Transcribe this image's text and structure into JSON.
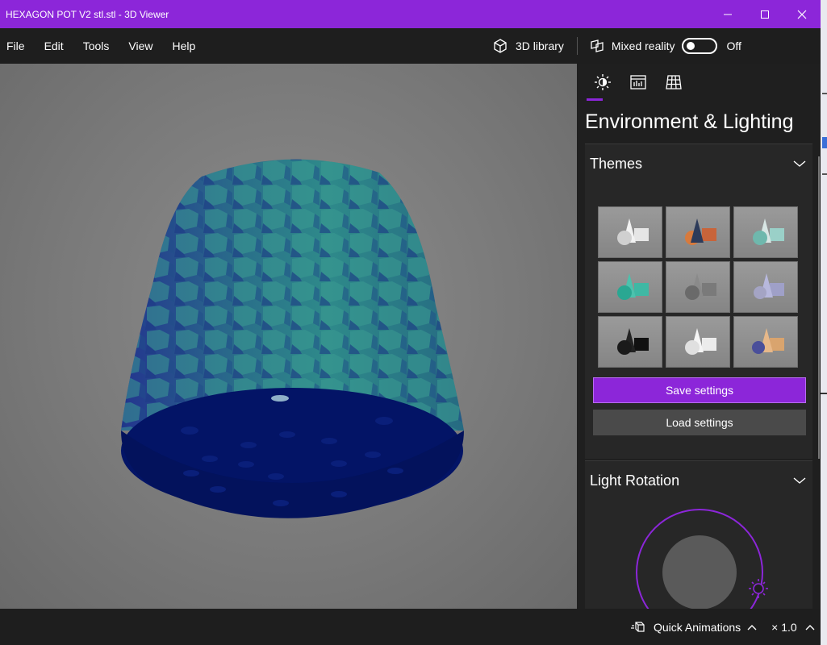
{
  "window": {
    "title": "HEXAGON POT V2 stl.stl - 3D Viewer",
    "accent": "#8c26d9"
  },
  "menu": {
    "items": [
      "File",
      "Edit",
      "Tools",
      "View",
      "Help"
    ],
    "library_label": "3D library",
    "mixed_reality_label": "Mixed reality",
    "mixed_reality_state": "Off"
  },
  "panel": {
    "tabs": [
      {
        "icon": "sun-settings-icon",
        "active": true
      },
      {
        "icon": "stats-icon",
        "active": false
      },
      {
        "icon": "grid-icon",
        "active": false
      }
    ],
    "heading": "Environment & Lighting",
    "themes_label": "Themes",
    "themes": [
      {
        "shapes": "white",
        "bg": "#9a9a9a"
      },
      {
        "shapes": "dark-orange",
        "bg": "#8f8f8f"
      },
      {
        "shapes": "teal-white",
        "bg": "#9a9a9a"
      },
      {
        "shapes": "teal",
        "bg": "#8a8a8a"
      },
      {
        "shapes": "gray",
        "bg": "#8f8f8f"
      },
      {
        "shapes": "lavender",
        "bg": "#9a9a9a"
      },
      {
        "shapes": "black",
        "bg": "#9a9a9a"
      },
      {
        "shapes": "white-soft",
        "bg": "#9a9a9a"
      },
      {
        "shapes": "multicolor",
        "bg": "#9a9a9a"
      }
    ],
    "save_label": "Save settings",
    "load_label": "Load settings",
    "light_rotation_label": "Light Rotation"
  },
  "statusbar": {
    "quick_animations_label": "Quick Animations",
    "speed_label": "× 1.0"
  }
}
